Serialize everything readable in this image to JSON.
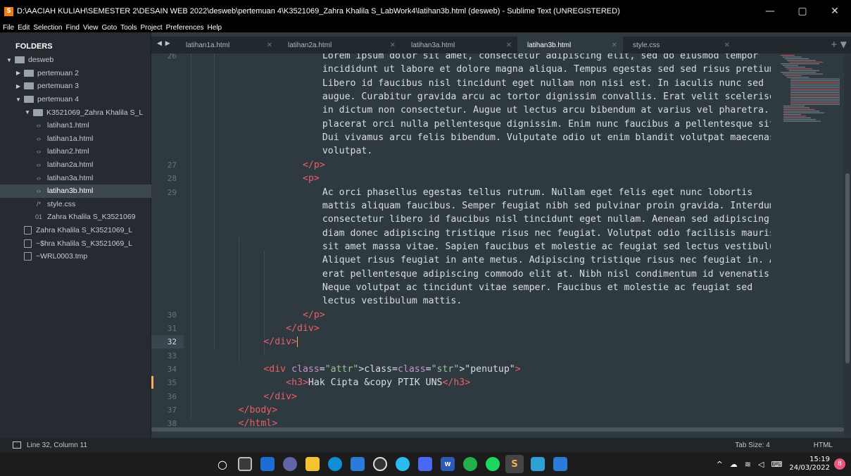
{
  "window": {
    "title": "D:\\AACIAH KULIAH\\SEMESTER 2\\DESAIN WEB 2022\\desweb\\pertemuan 4\\K3521069_Zahra Khalila S_LabWork4\\latihan3b.html (desweb) - Sublime Text (UNREGISTERED)",
    "minimize": "—",
    "maximize": "▢",
    "close": "✕"
  },
  "menu": [
    "File",
    "Edit",
    "Selection",
    "Find",
    "View",
    "Goto",
    "Tools",
    "Project",
    "Preferences",
    "Help"
  ],
  "sidebar": {
    "header": "FOLDERS",
    "items": [
      {
        "label": "desweb",
        "kind": "folder-open",
        "indent": 0
      },
      {
        "label": "pertemuan 2",
        "kind": "folder",
        "indent": 1
      },
      {
        "label": "pertemuan 3",
        "kind": "folder",
        "indent": 1
      },
      {
        "label": "pertemuan 4",
        "kind": "folder-open",
        "indent": 1
      },
      {
        "label": "K3521069_Zahra Khalila S_L",
        "kind": "folder-open",
        "indent": 2
      },
      {
        "label": "latihan1.html",
        "kind": "html",
        "indent": 3
      },
      {
        "label": "latihan1a.html",
        "kind": "html",
        "indent": 3
      },
      {
        "label": "latihan2.html",
        "kind": "html",
        "indent": 3
      },
      {
        "label": "latihan2a.html",
        "kind": "html",
        "indent": 3
      },
      {
        "label": "latihan3a.html",
        "kind": "html",
        "indent": 3
      },
      {
        "label": "latihan3b.html",
        "kind": "html",
        "indent": 3,
        "selected": true
      },
      {
        "label": "style.css",
        "kind": "css",
        "indent": 3
      },
      {
        "label": "Zahra Khalila S_K3521069",
        "kind": "binary",
        "indent": 3
      },
      {
        "label": "Zahra Khalila S_K3521069_L",
        "kind": "doc",
        "indent": 2
      },
      {
        "label": "~$hra Khalila S_K3521069_L",
        "kind": "doc",
        "indent": 2
      },
      {
        "label": "~WRL0003.tmp",
        "kind": "doc",
        "indent": 2
      }
    ]
  },
  "tabs": [
    {
      "label": "latihan1a.html"
    },
    {
      "label": "latihan2a.html"
    },
    {
      "label": "latihan3a.html"
    },
    {
      "label": "latihan3b.html",
      "active": true
    },
    {
      "label": "style.css"
    }
  ],
  "tab_nav": "◀ ▶",
  "tab_add": "+ ▼",
  "editor": {
    "lines": [
      {
        "n": "26",
        "indent": 0,
        "text": "Lorem ipsum dolor sit amet, consectetur adipiscing elit, sed do eiusmod tempor",
        "wrapped": true
      },
      {
        "n": "",
        "text": "incididunt ut labore et dolore magna aliqua. Tempus egestas sed sed risus pretium."
      },
      {
        "n": "",
        "text": "Libero id faucibus nisl tincidunt eget nullam non nisi est. In iaculis nunc sed"
      },
      {
        "n": "",
        "text": "augue. Curabitur gravida arcu ac tortor dignissim convallis. Erat velit scelerisque"
      },
      {
        "n": "",
        "text": "in dictum non consectetur. Augue ut lectus arcu bibendum at varius vel pharetra. Ut"
      },
      {
        "n": "",
        "text": "placerat orci nulla pellentesque dignissim. Enim nunc faucibus a pellentesque sit."
      },
      {
        "n": "",
        "text": "Dui vivamus arcu felis bibendum. Vulputate odio ut enim blandit volutpat maecenas"
      },
      {
        "n": "",
        "text": "volutpat."
      },
      {
        "n": "27",
        "text": "</p>"
      },
      {
        "n": "28",
        "text": "<p>"
      },
      {
        "n": "29",
        "text": "Ac orci phasellus egestas tellus rutrum. Nullam eget felis eget nunc lobortis"
      },
      {
        "n": "",
        "text": "mattis aliquam faucibus. Semper feugiat nibh sed pulvinar proin gravida. Interdum"
      },
      {
        "n": "",
        "text": "consectetur libero id faucibus nisl tincidunt eget nullam. Aenean sed adipiscing"
      },
      {
        "n": "",
        "text": "diam donec adipiscing tristique risus nec feugiat. Volutpat odio facilisis mauris"
      },
      {
        "n": "",
        "text": "sit amet massa vitae. Sapien faucibus et molestie ac feugiat sed lectus vestibulum."
      },
      {
        "n": "",
        "text": "Aliquet risus feugiat in ante metus. Adipiscing tristique risus nec feugiat in. At"
      },
      {
        "n": "",
        "text": "erat pellentesque adipiscing commodo elit at. Nibh nisl condimentum id venenatis."
      },
      {
        "n": "",
        "text": "Neque volutpat ac tincidunt vitae semper. Faucibus et molestie ac feugiat sed"
      },
      {
        "n": "",
        "text": "lectus vestibulum mattis."
      },
      {
        "n": "30",
        "text": "</p>"
      },
      {
        "n": "31",
        "text": "</div>"
      },
      {
        "n": "32",
        "text": "</div>"
      },
      {
        "n": "33",
        "text": ""
      },
      {
        "n": "34",
        "text": "<div class=\"penutup\">"
      },
      {
        "n": "35",
        "text": "<h3>Hak Cipta &copy PTIK UNS</h3>"
      },
      {
        "n": "36",
        "text": "</div>"
      },
      {
        "n": "37",
        "text": "</body>"
      },
      {
        "n": "38",
        "text": "</html>"
      }
    ]
  },
  "status": {
    "position": "Line 32, Column 11",
    "tab_size": "Tab Size: 4",
    "syntax": "HTML"
  },
  "taskbar": {
    "time": "15:19",
    "date": "24/03/2022",
    "notifications": "8",
    "tray_chevron": "^"
  },
  "colors": {
    "editor_bg": "#2f3940",
    "sidebar_bg": "#252b30",
    "tag": "#ec5f67",
    "attr": "#c594c5",
    "string": "#99c794",
    "caret": "#f9ae58"
  }
}
